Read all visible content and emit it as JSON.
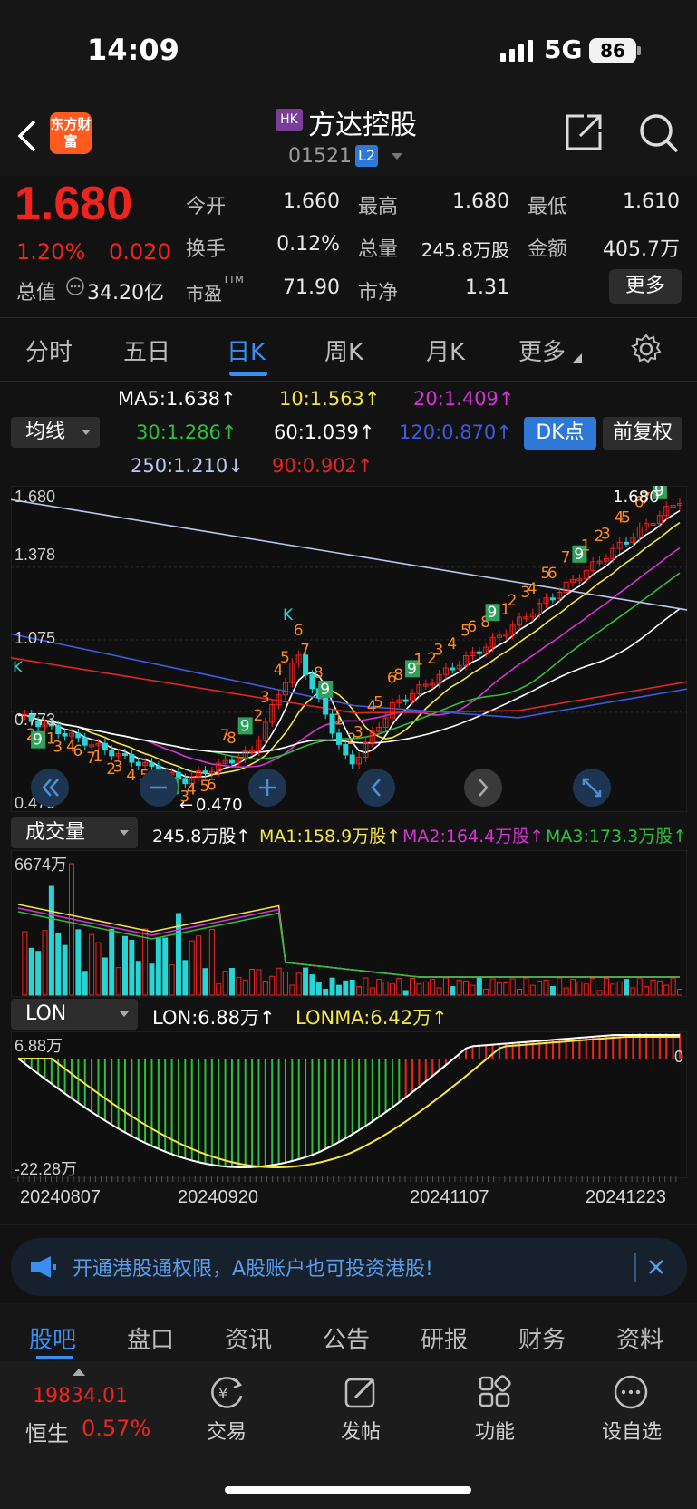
{
  "status_bar": {
    "time": "14:09",
    "network": "5G",
    "battery": "86"
  },
  "header": {
    "logo_text": "东方财富",
    "market_badge": "HK",
    "stock_name": "方达控股",
    "stock_code": "01521",
    "level_badge": "L2"
  },
  "quote": {
    "price": "1.680",
    "change_pct": "1.20%",
    "change_amt": "0.020",
    "open_label": "今开",
    "open": "1.660",
    "high_label": "最高",
    "high": "1.680",
    "low_label": "最低",
    "low": "1.610",
    "turnover_label": "换手",
    "turnover": "0.12%",
    "volume_label": "总量",
    "volume": "245.8万股",
    "amount_label": "金额",
    "amount": "405.7万",
    "mcap_label": "总值",
    "mcap": "34.20亿",
    "pe_label": "市盈",
    "pe_sup": "TTM",
    "pe": "71.90",
    "pb_label": "市净",
    "pb": "1.31",
    "more_label": "更多"
  },
  "period_tabs": [
    "分时",
    "五日",
    "日K",
    "周K",
    "月K",
    "更多"
  ],
  "active_period": "日K",
  "indicators": {
    "selector_label": "均线",
    "ma5": "MA5:1.638↑",
    "ma10": "10:1.563↑",
    "ma20": "20:1.409↑",
    "ma30": "30:1.286↑",
    "ma60": "60:1.039↑",
    "ma120": "120:0.870↑",
    "ma250": "250:1.210↓",
    "ma90": "90:0.902↑",
    "dk_label": "DK点",
    "fq_label": "前复权",
    "colors": {
      "ma5": "#ffffff",
      "ma10": "#f5e642",
      "ma20": "#d633d6",
      "ma30": "#2fbf3a",
      "ma60": "#ffffff",
      "ma120": "#3f5ae0",
      "ma250": "#b8c8f0",
      "ma90": "#e02626"
    }
  },
  "price_chart": {
    "type": "candlestick",
    "y_ticks": [
      "1.680",
      "1.378",
      "1.075",
      "0.773",
      "0.470"
    ],
    "ylim": [
      0.47,
      1.68
    ],
    "last_price_label": "1.680",
    "low_marker_label": "0.470",
    "k_labels": [
      "K",
      "K"
    ],
    "dk_markers": [
      "2",
      "9",
      "1",
      "3",
      "4",
      "6",
      "7",
      "1",
      "2",
      "3",
      "4",
      "5",
      "6",
      "7",
      "9",
      "3",
      "4",
      "5",
      "6",
      "7",
      "8",
      "9",
      "2",
      "3",
      "4",
      "5",
      "6",
      "7",
      "8",
      "9",
      "1",
      "2",
      "3",
      "4",
      "5",
      "6",
      "8",
      "9",
      "1",
      "2",
      "3",
      "4",
      "5",
      "6",
      "8",
      "9",
      "1",
      "2",
      "3",
      "4",
      "5",
      "6",
      "7",
      "9",
      "1",
      "2",
      "3",
      "4",
      "5",
      "6",
      "7",
      "9"
    ]
  },
  "volume_panel": {
    "selector_label": "成交量",
    "vol": "245.8万股↑",
    "ma1": "MA1:158.9万股↑",
    "ma2": "MA2:164.4万股↑",
    "ma3": "MA3:173.3万股↑",
    "y_top": "6674万"
  },
  "lon_panel": {
    "selector_label": "LON",
    "lon": "LON:6.88万↑",
    "lonma": "LONMA:6.42万↑",
    "y_top": "6.88万",
    "y_bottom": "-22.28万",
    "zero_label": "0"
  },
  "x_dates": [
    "20240807",
    "20240920",
    "20241107",
    "20241223"
  ],
  "banner": {
    "text": "开通港股通权限，A股账户也可投资港股!"
  },
  "bottom_tabs": [
    "股吧",
    "盘口",
    "资讯",
    "公告",
    "研报",
    "财务",
    "资料"
  ],
  "footer": {
    "index_value": "19834.01",
    "index_name": "恒生",
    "index_change": "0.57%",
    "items": [
      "交易",
      "发帖",
      "功能",
      "设自选"
    ]
  }
}
